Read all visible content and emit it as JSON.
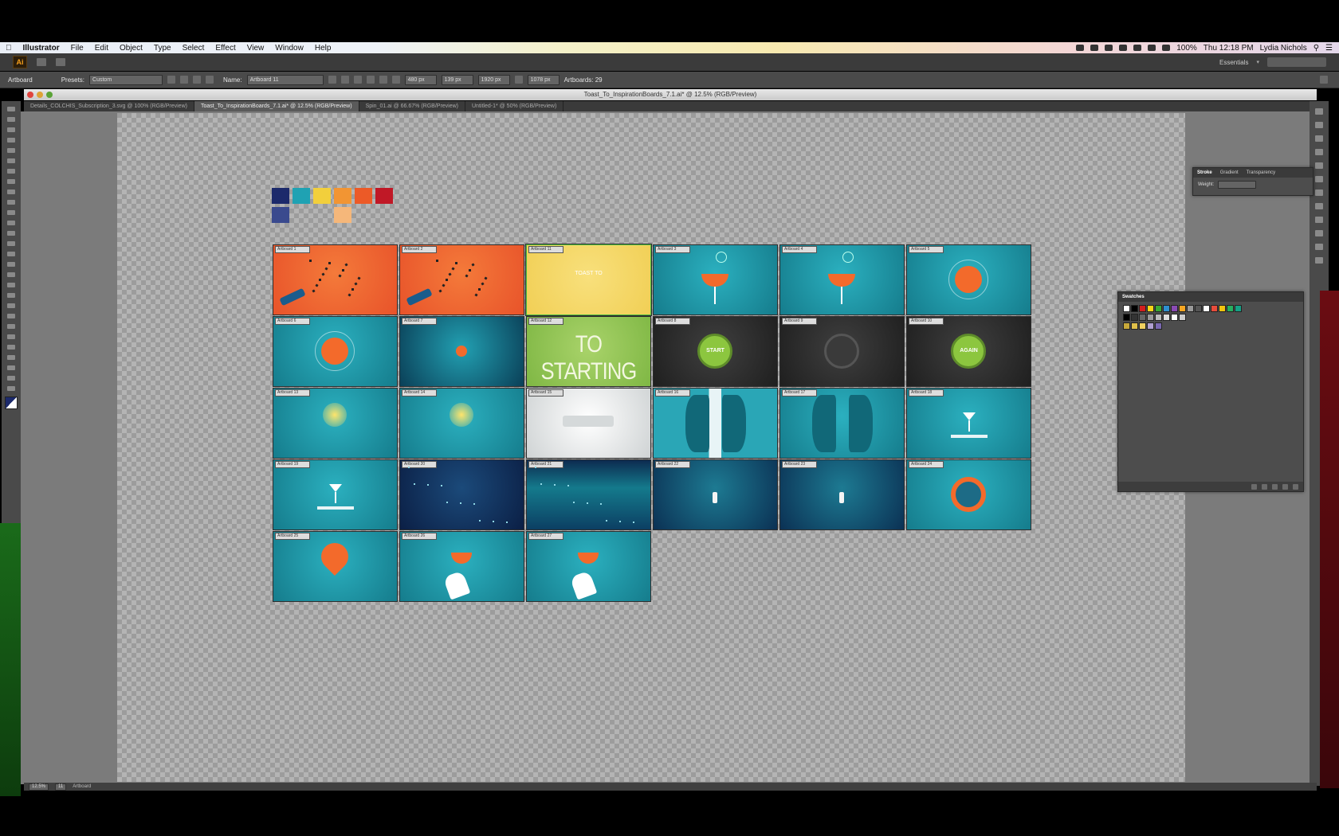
{
  "menubar": {
    "items": [
      {
        "label": "Illustrator",
        "bold": true
      },
      {
        "label": "File"
      },
      {
        "label": "Edit"
      },
      {
        "label": "Object"
      },
      {
        "label": "Type"
      },
      {
        "label": "Select"
      },
      {
        "label": "Effect"
      },
      {
        "label": "View"
      },
      {
        "label": "Window"
      },
      {
        "label": "Help"
      }
    ],
    "battery": "100%",
    "clock": "Thu 12:18 PM",
    "user": "Lydia Nichols"
  },
  "appbar": {
    "logo": "Ai",
    "workspace": "Essentials"
  },
  "controlbar": {
    "mode_label": "Artboard",
    "presets_label": "Presets:",
    "presets_value": "Custom",
    "name_label": "Name:",
    "name_value": "Artboard 11",
    "x_value": "480 px",
    "y_value": "139 px",
    "w_value": "1920 px",
    "h_value": "1078 px",
    "artboards_label": "Artboards: 29"
  },
  "document": {
    "title": "Toast_To_InspirationBoards_7.1.ai* @ 12.5% (RGB/Preview)"
  },
  "tabs": [
    {
      "label": "Details_COLCHIS_Subscription_3.svg @ 100% (RGB/Preview)",
      "active": false
    },
    {
      "label": "Toast_To_InspirationBoards_7.1.ai* @ 12.5% (RGB/Preview)",
      "active": true
    },
    {
      "label": "Spin_01.ai @ 66.67% (RGB/Preview)",
      "active": false
    },
    {
      "label": "Untitled-1* @ 50% (RGB/Preview)",
      "active": false
    }
  ],
  "colors": {
    "swatches_top": [
      "#1c2a6b",
      "#1fa2b3",
      "#f2cf3c",
      "#f29533",
      "#ec5a27",
      "#c01826"
    ],
    "swatches_bottom": [
      "#3a4a8e",
      "",
      "",
      "#f5b77a",
      "",
      ""
    ],
    "teal": "#1b8fa0",
    "orange": "#f36a2b",
    "yellow": "#f4d765",
    "green": "#8fc04d",
    "dark": "#2a2a2a"
  },
  "artboards": [
    {
      "label": "Artboard 1",
      "style": "orange",
      "motif": "confetti"
    },
    {
      "label": "Artboard 2",
      "style": "orange",
      "motif": "confetti"
    },
    {
      "label": "Artboard 11",
      "style": "yellow",
      "motif": "text",
      "text": "TOAST TO",
      "selected": true
    },
    {
      "label": "Artboard 3",
      "style": "teal",
      "motif": "glass"
    },
    {
      "label": "Artboard 4",
      "style": "teal",
      "motif": "glass"
    },
    {
      "label": "Artboard 5",
      "style": "teal",
      "motif": "orange-target"
    },
    {
      "label": "Artboard 6",
      "style": "teal",
      "motif": "orange-target"
    },
    {
      "label": "Artboard 7",
      "style": "teal-dark",
      "motif": "orange-dot"
    },
    {
      "label": "Artboard 12",
      "style": "green",
      "motif": "big-text",
      "text": "TO STARTING"
    },
    {
      "label": "Artboard 8",
      "style": "dark",
      "motif": "green-button",
      "text": "START"
    },
    {
      "label": "Artboard 9",
      "style": "dark",
      "motif": "grey-button"
    },
    {
      "label": "Artboard 10",
      "style": "dark",
      "motif": "green-button",
      "text": "AGAIN"
    },
    {
      "label": "Artboard 13",
      "style": "teal",
      "motif": "light"
    },
    {
      "label": "Artboard 14",
      "style": "teal",
      "motif": "light"
    },
    {
      "label": "Artboard 15",
      "style": "white",
      "motif": "sketch"
    },
    {
      "label": "Artboard 16",
      "style": "teal-white",
      "motif": "faces"
    },
    {
      "label": "Artboard 17",
      "style": "teal",
      "motif": "faces"
    },
    {
      "label": "Artboard 18",
      "style": "teal",
      "motif": "drink"
    },
    {
      "label": "Artboard 19",
      "style": "teal",
      "motif": "drink"
    },
    {
      "label": "Artboard 20",
      "style": "navy",
      "motif": "sparkles"
    },
    {
      "label": "Artboard 21",
      "style": "navy-teal",
      "motif": "water"
    },
    {
      "label": "Artboard 22",
      "style": "deep",
      "motif": "bottle"
    },
    {
      "label": "Artboard 23",
      "style": "deep",
      "motif": "bottle"
    },
    {
      "label": "Artboard 24",
      "style": "teal",
      "motif": "ring"
    },
    {
      "label": "Artboard 25",
      "style": "teal",
      "motif": "pin"
    },
    {
      "label": "Artboard 26",
      "style": "teal",
      "motif": "hand"
    },
    {
      "label": "Artboard 27",
      "style": "teal",
      "motif": "hand"
    }
  ],
  "stroke_panel": {
    "tabs": [
      "Stroke",
      "Gradient",
      "Transparency"
    ],
    "weight_label": "Weight:",
    "weight_value": ""
  },
  "swatches_panel": {
    "title": "Swatches",
    "row_colors": [
      "#ffffff",
      "#000000",
      "#d21e1e",
      "#f7d417",
      "#3aa935",
      "#2e8fd0",
      "#8a4bb4",
      "#f5a623",
      "#999999",
      "#555555",
      "#ffffff",
      "#e74c3c",
      "#f1c40f",
      "#27ae60",
      "#16a085"
    ],
    "row2_colors": [
      "#000000",
      "#333333",
      "#666666",
      "#999999",
      "#bbbbbb",
      "#dddddd",
      "#ffffff",
      "#cccccc"
    ],
    "row3_colors": [
      "#c8a93a",
      "#e0c04a",
      "#f0d060",
      "#b0a0d0",
      "#7a68b0"
    ]
  },
  "statusbar": {
    "zoom": "12.5%",
    "page": "11",
    "mode": "Artboard"
  }
}
